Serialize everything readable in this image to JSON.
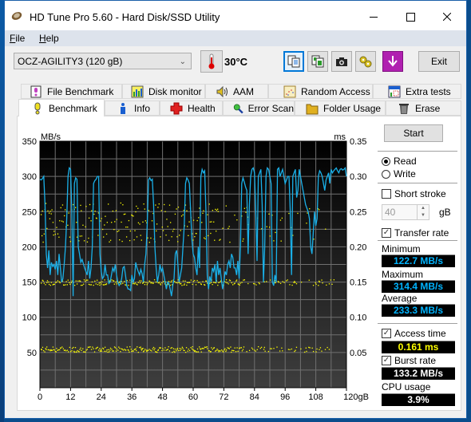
{
  "window": {
    "title": "HD Tune Pro 5.60 - Hard Disk/SSD Utility",
    "controls": [
      "minimize",
      "maximize",
      "close"
    ]
  },
  "menu": [
    {
      "label": "File",
      "accel": "F",
      "rest": "ile"
    },
    {
      "label": "Help",
      "accel": "H",
      "rest": "elp"
    }
  ],
  "toolbar": {
    "drive": "OCZ-AGILITY3 (120 gB)",
    "temperature": "30°C",
    "buttons": [
      "copy-text-icon",
      "copy-image-icon",
      "camera-icon",
      "options-icon",
      "save-icon"
    ],
    "exit_label": "Exit"
  },
  "tabs": {
    "row1": [
      {
        "label": "File Benchmark",
        "icon": "file-benchmark-icon"
      },
      {
        "label": "Disk monitor",
        "icon": "disk-monitor-icon"
      },
      {
        "label": "AAM",
        "icon": "speaker-icon"
      },
      {
        "label": "Random Access",
        "icon": "random-access-icon"
      },
      {
        "label": "Extra tests",
        "icon": "extra-tests-icon"
      }
    ],
    "row2": [
      {
        "label": "Benchmark",
        "icon": "exclamation-icon",
        "selected": true
      },
      {
        "label": "Info",
        "icon": "info-icon"
      },
      {
        "label": "Health",
        "icon": "health-cross-icon"
      },
      {
        "label": "Error Scan",
        "icon": "magnifier-icon"
      },
      {
        "label": "Folder Usage",
        "icon": "folder-icon"
      },
      {
        "label": "Erase",
        "icon": "trash-icon"
      }
    ]
  },
  "side": {
    "start_label": "Start",
    "read_label": "Read",
    "write_label": "Write",
    "mode": "Read",
    "short_stroke_label": "Short stroke",
    "short_stroke_checked": false,
    "short_stroke_value": "40",
    "short_stroke_unit": "gB",
    "transfer_rate_label": "Transfer rate",
    "transfer_rate_checked": true,
    "minimum_label": "Minimum",
    "minimum_value": "122.7 MB/s",
    "maximum_label": "Maximum",
    "maximum_value": "314.4 MB/s",
    "average_label": "Average",
    "average_value": "233.3 MB/s",
    "access_time_label": "Access time",
    "access_time_checked": true,
    "access_time_value": "0.161 ms",
    "burst_rate_label": "Burst rate",
    "burst_rate_checked": true,
    "burst_rate_value": "133.2 MB/s",
    "cpu_usage_label": "CPU usage",
    "cpu_usage_value": "3.9%"
  },
  "colors": {
    "transfer_line": "#1ab0e8",
    "access_dots": "#ffff00",
    "plot_bg_top": "#000000",
    "plot_bg_bottom": "#3e3e3e",
    "grid": "#707070"
  },
  "chart_data": {
    "type": "line",
    "title": "",
    "xlabel": "gB",
    "ylabel_left": "MB/s",
    "ylabel_right": "ms",
    "xlim": [
      0,
      120
    ],
    "ylim_left": [
      0,
      350
    ],
    "ylim_right": [
      0,
      0.35
    ],
    "x_ticks": [
      "0",
      "12",
      "24",
      "36",
      "48",
      "60",
      "72",
      "84",
      "96",
      "108",
      "120gB"
    ],
    "y_ticks_left": [
      "350",
      "300",
      "250",
      "200",
      "150",
      "100",
      "50"
    ],
    "y_ticks_right": [
      "0.35",
      "0.30",
      "0.25",
      "0.20",
      "0.15",
      "0.10",
      "0.05"
    ],
    "grid": true,
    "series": [
      {
        "name": "Transfer rate (MB/s)",
        "axis": "left",
        "x": [
          0,
          0.5,
          1,
          1.5,
          2,
          2.5,
          3,
          3.5,
          4,
          4.5,
          5,
          5.5,
          6,
          6.5,
          7,
          7.5,
          8,
          8.5,
          9,
          9.5,
          10,
          10.5,
          11,
          11.5,
          12,
          12.5,
          13,
          13.5,
          14,
          14.5,
          15,
          15.5,
          16,
          16.5,
          17,
          17.5,
          18,
          18.5,
          19,
          19.5,
          20,
          20.5,
          21,
          21.5,
          22,
          22.5,
          23,
          23.5,
          24,
          24.5,
          25,
          25.5,
          26,
          26.5,
          27,
          27.5,
          28,
          28.5,
          29,
          29.5,
          30,
          30.5,
          31,
          31.5,
          32,
          32.5,
          33,
          33.5,
          34,
          34.5,
          35,
          35.5,
          36,
          36.5,
          37,
          37.5,
          38,
          38.5,
          39,
          39.5,
          40,
          40.5,
          41,
          41.5,
          42,
          42.5,
          43,
          43.5,
          44,
          44.5,
          45,
          45.5,
          46,
          46.5,
          47,
          47.5,
          48,
          48.5,
          49,
          49.5,
          50,
          50.5,
          51,
          51.5,
          52,
          52.5,
          53,
          53.5,
          54,
          54.5,
          55,
          55.5,
          56,
          56.5,
          57,
          57.5,
          58,
          58.5,
          59,
          59.5,
          60,
          60.5,
          61,
          61.5,
          62,
          62.5,
          63,
          63.5,
          64,
          64.5,
          65,
          65.5,
          66,
          66.5,
          67,
          67.5,
          68,
          68.5,
          69,
          69.5,
          70,
          70.5,
          71,
          71.5,
          72,
          72.5,
          73,
          73.5,
          74,
          74.5,
          75,
          75.5,
          76,
          76.5,
          77,
          77.5,
          78,
          78.5,
          79,
          79.5,
          80,
          80.5,
          81,
          81.5,
          82,
          82.5,
          83,
          83.5,
          84,
          84.5,
          85,
          85.5,
          86,
          86.5,
          87,
          87.5,
          88,
          88.5,
          89,
          89.5,
          90,
          90.5,
          91,
          91.5,
          92,
          92.5,
          93,
          93.5,
          94,
          94.5,
          95,
          95.5,
          96,
          96.5,
          97,
          97.5,
          98,
          98.5,
          99,
          99.5,
          100,
          100.5,
          101,
          101.5,
          102,
          102.5,
          103,
          103.5,
          104,
          104.5,
          105,
          105.5,
          106,
          106.5,
          107,
          107.5,
          108,
          108.5,
          109,
          109.5,
          110,
          110.5,
          111,
          111.5,
          112,
          112.5,
          113,
          113.5,
          114,
          114.5,
          115,
          115.5,
          116,
          116.5,
          117,
          117.5,
          118,
          118.5,
          119,
          119.5,
          120
        ],
        "y": [
          296,
          295,
          297,
          300,
          260,
          190,
          170,
          195,
          160,
          178,
          172,
          175,
          168,
          180,
          160,
          190,
          170,
          150,
          155,
          175,
          200,
          240,
          300,
          312,
          310,
          250,
          130,
          290,
          298,
          296,
          200,
          190,
          178,
          182,
          176,
          170,
          165,
          160,
          180,
          155,
          170,
          200,
          290,
          294,
          296,
          300,
          300,
          190,
          165,
          155,
          158,
          175,
          160,
          160,
          148,
          150,
          160,
          170,
          165,
          175,
          160,
          150,
          145,
          148,
          155,
          170,
          172,
          160,
          145,
          140,
          140,
          138,
          160,
          150,
          155,
          178,
          170,
          165,
          160,
          168,
          162,
          150,
          175,
          190,
          230,
          295,
          298,
          294,
          296,
          260,
          200,
          170,
          150,
          160,
          175,
          165,
          170,
          160,
          150,
          140,
          150,
          148,
          140,
          130,
          145,
          155,
          190,
          195,
          175,
          150,
          160,
          170,
          200,
          230,
          290,
          298,
          295,
          290,
          250,
          210,
          190,
          185,
          170,
          160,
          200,
          170,
          300,
          310,
          305,
          308,
          250,
          160,
          140,
          158,
          150,
          170,
          165,
          175,
          150,
          180,
          160,
          170,
          155,
          140,
          150,
          165,
          160,
          175,
          180,
          170,
          190,
          185,
          170,
          170,
          160,
          180,
          155,
          200,
          290,
          298,
          292,
          285,
          280,
          190,
          260,
          300,
          310,
          312,
          305,
          250,
          180,
          300,
          305,
          310,
          260,
          150,
          200,
          300,
          312,
          310,
          300,
          290,
          150,
          145,
          160,
          150,
          310,
          312,
          300,
          305,
          310,
          300,
          290,
          295,
          300,
          300,
          250,
          160,
          300,
          305,
          310,
          270,
          280,
          310,
          300,
          290,
          280,
          270,
          260,
          255,
          250,
          240,
          200,
          190,
          220,
          250,
          230,
          240,
          300,
          308,
          305,
          300,
          290,
          280,
          295,
          300,
          305,
          290,
          310,
          305,
          308,
          310,
          312,
          308,
          305,
          310,
          311,
          309,
          310,
          312,
          300,
          309,
          310,
          313
        ]
      },
      {
        "name": "Access time (ms)",
        "axis": "right",
        "type": "scatter",
        "bands_ms": [
          0.055,
          0.15,
          0.23
        ],
        "count": "≈ 1 per 0.3 gB",
        "note": "scattered dots in three bands near 0.055, 0.150, and 0.210–0.260 ms"
      }
    ]
  }
}
